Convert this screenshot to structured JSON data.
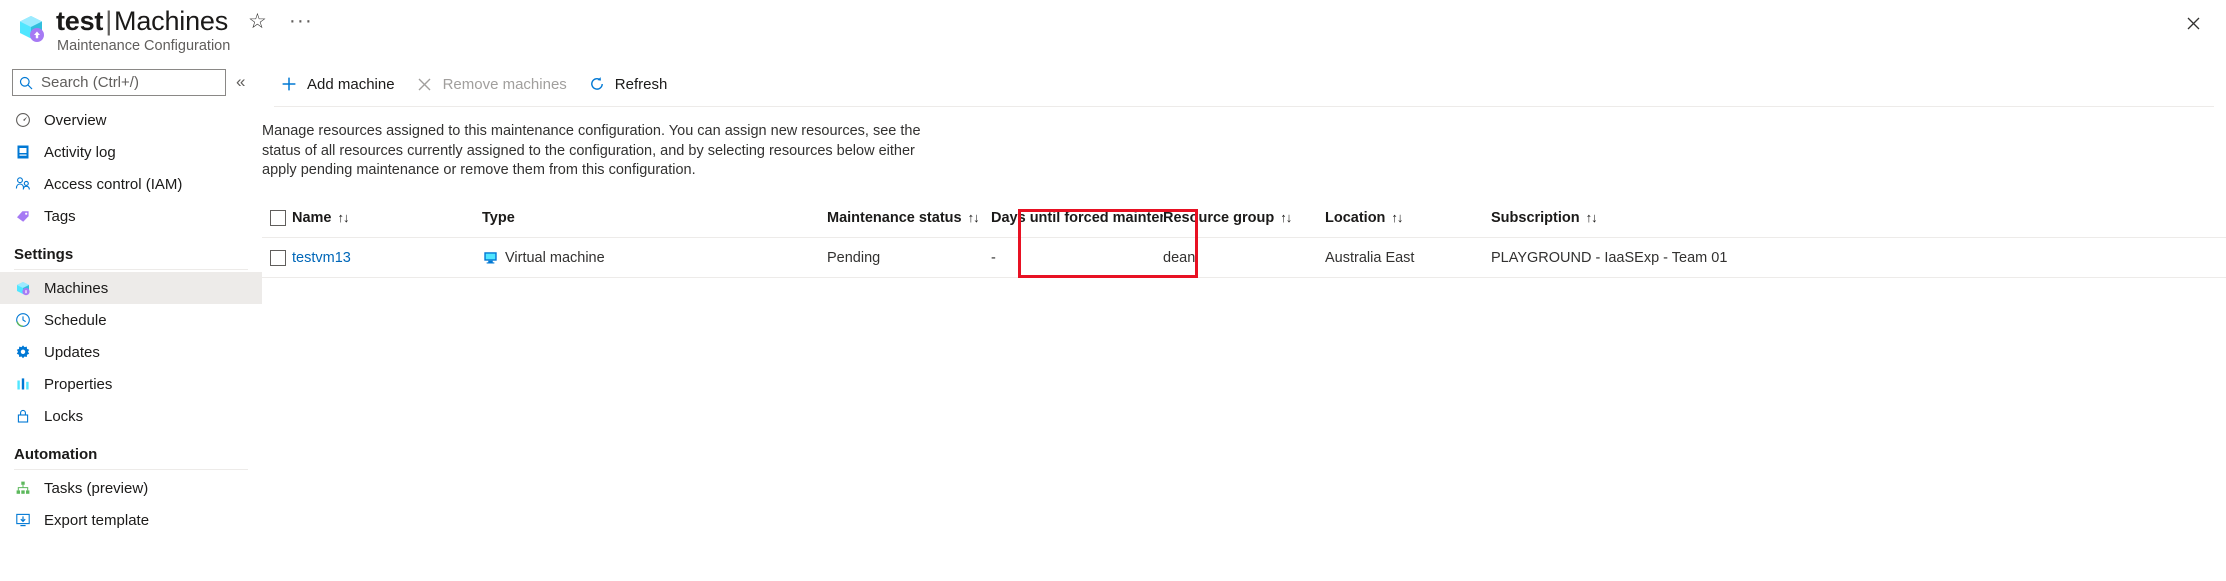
{
  "header": {
    "resource_icon": "maintenance-configuration-icon",
    "title_resource": "test",
    "title_separator": "|",
    "title_section": "Machines",
    "subtitle": "Maintenance Configuration",
    "favorite_icon": "star-icon",
    "more_icon": "ellipsis-icon",
    "close_icon": "close-icon"
  },
  "sidebar": {
    "search": {
      "placeholder": "Search (Ctrl+/)",
      "value": "",
      "icon": "search-icon"
    },
    "collapse_icon": "chevron-double-left-icon",
    "items": [
      {
        "label": "Overview",
        "icon": "overview-icon",
        "selected": false
      },
      {
        "label": "Activity log",
        "icon": "activity-log-icon",
        "selected": false
      },
      {
        "label": "Access control (IAM)",
        "icon": "access-control-icon",
        "selected": false
      },
      {
        "label": "Tags",
        "icon": "tags-icon",
        "selected": false
      }
    ],
    "groups": [
      {
        "label": "Settings",
        "items": [
          {
            "label": "Machines",
            "icon": "machines-icon",
            "selected": true
          },
          {
            "label": "Schedule",
            "icon": "schedule-icon",
            "selected": false
          },
          {
            "label": "Updates",
            "icon": "updates-icon",
            "selected": false
          },
          {
            "label": "Properties",
            "icon": "properties-icon",
            "selected": false
          },
          {
            "label": "Locks",
            "icon": "lock-icon",
            "selected": false
          }
        ]
      },
      {
        "label": "Automation",
        "items": [
          {
            "label": "Tasks (preview)",
            "icon": "tasks-icon",
            "selected": false
          },
          {
            "label": "Export template",
            "icon": "export-template-icon",
            "selected": false
          }
        ]
      }
    ]
  },
  "toolbar": {
    "add_machine": {
      "label": "Add machine",
      "icon": "plus-icon",
      "disabled": false
    },
    "remove_machines": {
      "label": "Remove machines",
      "icon": "cross-icon",
      "disabled": true
    },
    "refresh": {
      "label": "Refresh",
      "icon": "refresh-icon",
      "disabled": false
    }
  },
  "description": "Manage resources assigned to this maintenance configuration. You can assign new resources, see the status of all resources currently assigned to the configuration, and by selecting resources below either apply pending maintenance or remove them from this configuration.",
  "table": {
    "sort_glyph": "↑↓",
    "columns": [
      {
        "key": "name",
        "label": "Name",
        "sortable": true
      },
      {
        "key": "type",
        "label": "Type",
        "sortable": false
      },
      {
        "key": "status",
        "label": "Maintenance status",
        "sortable": true
      },
      {
        "key": "days",
        "label": "Days until forced maintenance",
        "sortable": true
      },
      {
        "key": "rg",
        "label": "Resource group",
        "sortable": true
      },
      {
        "key": "loc",
        "label": "Location",
        "sortable": true
      },
      {
        "key": "sub",
        "label": "Subscription",
        "sortable": true
      }
    ],
    "rows": [
      {
        "selected": false,
        "name": "testvm13",
        "type": "Virtual machine",
        "type_icon": "virtual-machine-icon",
        "status": "Pending",
        "days": "-",
        "rg": "dean",
        "loc": "Australia East",
        "sub": "PLAYGROUND - IaaSExp - Team 01"
      }
    ]
  },
  "annotation": {
    "highlight_color": "#e81123",
    "target": "maintenance-status-column"
  }
}
